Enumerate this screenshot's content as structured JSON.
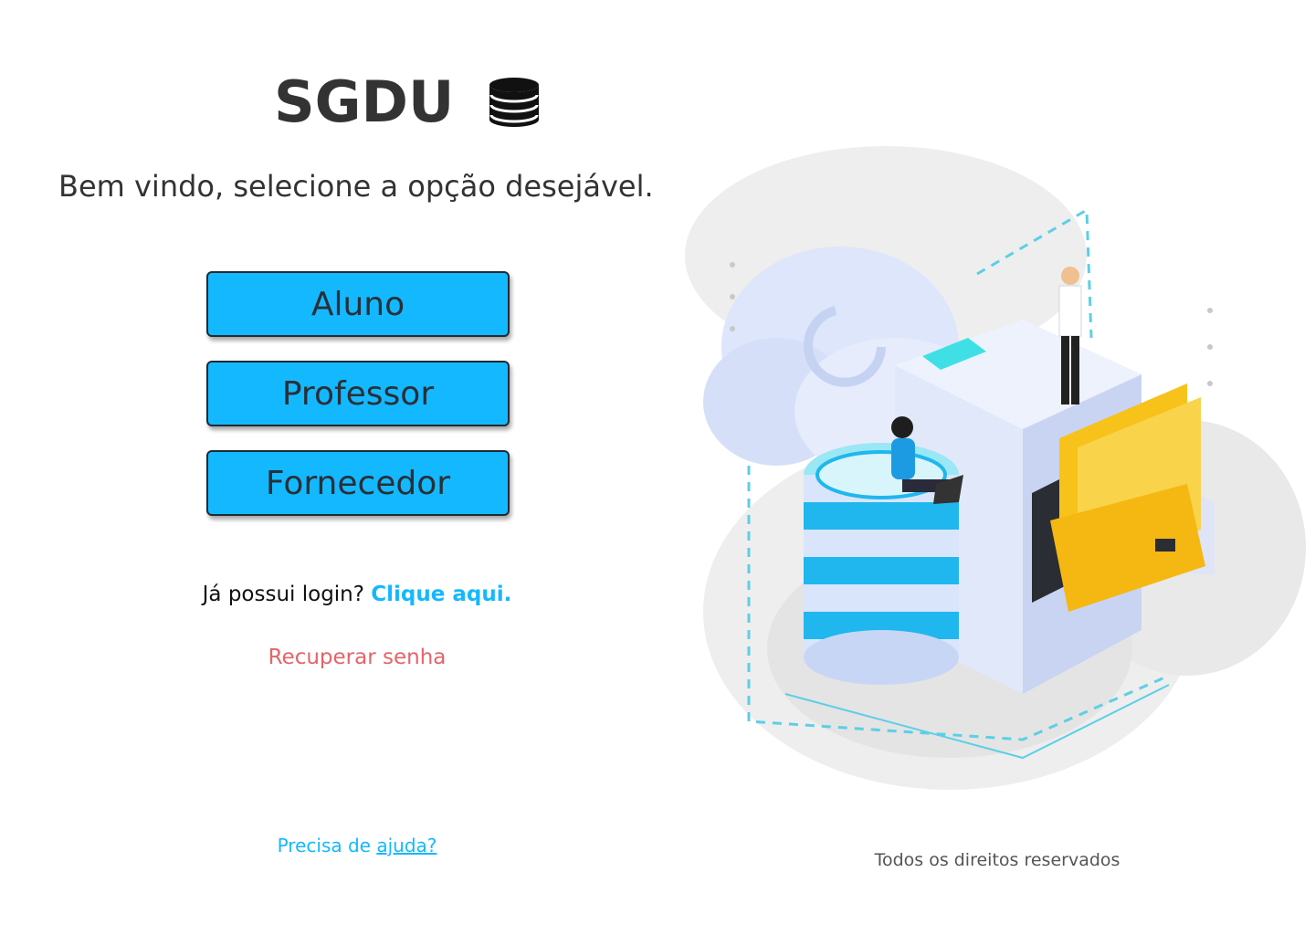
{
  "brand": {
    "title": "SGDU",
    "icon": "database-icon"
  },
  "welcome": "Bem vindo, selecione a opção desejável.",
  "roles": {
    "aluno": "Aluno",
    "professor": "Professor",
    "fornecedor": "Fornecedor"
  },
  "login": {
    "prompt": "Já possui login?",
    "link": "Clique aqui."
  },
  "recover": "Recuperar senha",
  "help": {
    "prefix": "Precisa de",
    "link": "ajuda?"
  },
  "footer": "Todos os direitos reservados",
  "colors": {
    "accent": "#14b8ff",
    "button_text": "#2a2f36",
    "recover": "#e5646a",
    "heading": "#333333"
  },
  "illustration": {
    "icon": "cloud-database-illustration"
  }
}
